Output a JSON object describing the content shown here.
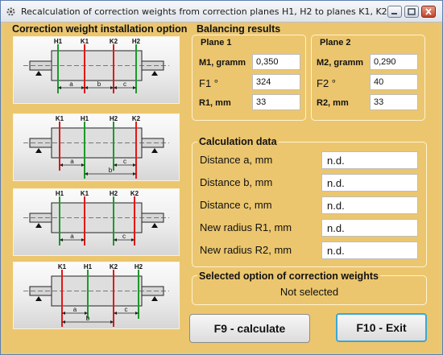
{
  "window": {
    "title": "Recalculation of correction weights  from  correction planes H1, H2  to  planes K1, K2"
  },
  "install": {
    "title": "Correction weight  installation option",
    "options": [
      {
        "top_labels": [
          "H1",
          "K1",
          "K2",
          "H2"
        ],
        "bottom_labels": [
          "a",
          "b",
          "c"
        ]
      },
      {
        "top_labels": [
          "K1",
          "H1",
          "H2",
          "K2"
        ],
        "bottom_labels": [
          "a",
          "c",
          "b"
        ]
      },
      {
        "top_labels": [
          "H1",
          "K1",
          "H2",
          "K2"
        ],
        "bottom_labels": [
          "a",
          "c"
        ]
      },
      {
        "top_labels": [
          "K1",
          "H1",
          "K2",
          "H2"
        ],
        "bottom_labels": [
          "a",
          "c",
          "b"
        ]
      }
    ]
  },
  "balancing": {
    "title": "Balancing results",
    "plane1": {
      "title": "Plane 1",
      "mass_label": "M1, gramm",
      "mass": "0,350",
      "angle_label": "F1 °",
      "angle": "324",
      "radius_label": "R1, mm",
      "radius": "33"
    },
    "plane2": {
      "title": "Plane 2",
      "mass_label": "M2, gramm",
      "mass": "0,290",
      "angle_label": "F2 °",
      "angle": "40",
      "radius_label": "R2, mm",
      "radius": "33"
    }
  },
  "calc": {
    "title": "Calculation data",
    "rows": [
      {
        "label": "Distance a, mm",
        "value": "n.d."
      },
      {
        "label": "Distance b, mm",
        "value": "n.d."
      },
      {
        "label": "Distance c, mm",
        "value": "n.d."
      },
      {
        "label": "New radius R1, mm",
        "value": "n.d."
      },
      {
        "label": "New radius R2, mm",
        "value": "n.d."
      }
    ]
  },
  "selected": {
    "title": "Selected option of correction weights",
    "value": "Not selected"
  },
  "buttons": {
    "calculate": "F9 - calculate",
    "exit": "F10 - Exit"
  },
  "colors": {
    "background": "#ecc66e",
    "plane_h": "#1a9a2a",
    "plane_k": "#e01818"
  }
}
